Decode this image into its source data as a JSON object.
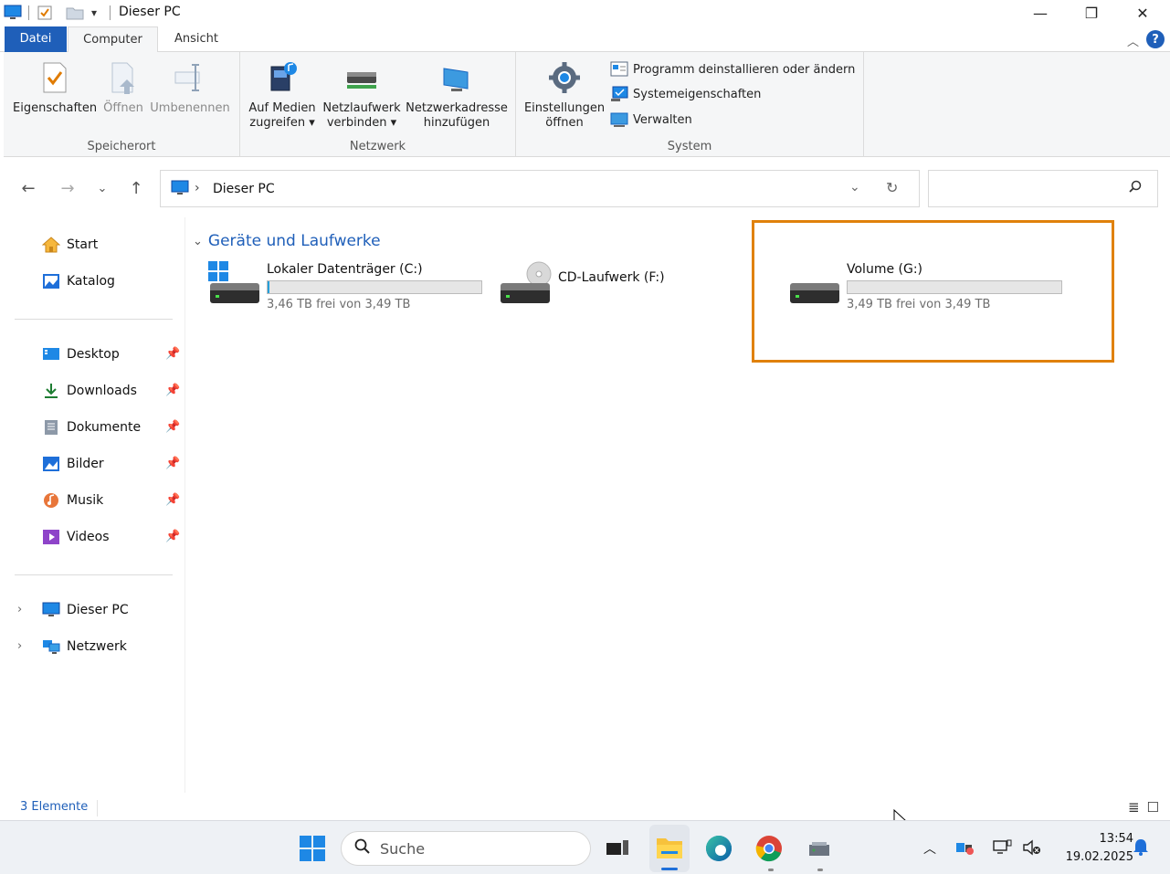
{
  "window": {
    "title": "Dieser PC",
    "minimize_glyph": "—",
    "restore_glyph": "❐",
    "close_glyph": "✕"
  },
  "ribbon": {
    "tabs": {
      "file": "Datei",
      "computer": "Computer",
      "view": "Ansicht"
    },
    "groups": {
      "location": {
        "label": "Speicherort",
        "buttons": {
          "properties": "Eigenschaften",
          "open": "Öffnen",
          "rename": "Umbenennen"
        }
      },
      "network": {
        "label": "Netzwerk",
        "buttons": {
          "media_line1": "Auf Medien",
          "media_line2": "zugreifen ▾",
          "map_drive_line1": "Netzlaufwerk",
          "map_drive_line2": "verbinden ▾",
          "add_location_line1": "Netzwerkadresse",
          "add_location_line2": "hinzufügen"
        }
      },
      "system": {
        "label": "System",
        "buttons": {
          "settings_line1": "Einstellungen",
          "settings_line2": "öffnen",
          "uninstall": "Programm deinstallieren oder ändern",
          "system_properties": "Systemeigenschaften",
          "manage": "Verwalten"
        }
      }
    }
  },
  "address_bar": {
    "path": "Dieser PC",
    "separator": "›"
  },
  "sidebar": {
    "top": [
      {
        "label": "Start",
        "icon": "home-icon"
      },
      {
        "label": "Katalog",
        "icon": "gallery-icon"
      }
    ],
    "pinned": [
      {
        "label": "Desktop",
        "icon": "desktop-icon"
      },
      {
        "label": "Downloads",
        "icon": "download-icon"
      },
      {
        "label": "Dokumente",
        "icon": "documents-icon"
      },
      {
        "label": "Bilder",
        "icon": "pictures-icon"
      },
      {
        "label": "Musik",
        "icon": "music-icon"
      },
      {
        "label": "Videos",
        "icon": "videos-icon"
      }
    ],
    "tree": [
      {
        "label": "Dieser PC",
        "icon": "this-pc-icon"
      },
      {
        "label": "Netzwerk",
        "icon": "network-icon"
      }
    ]
  },
  "content": {
    "section_title": "Geräte und Laufwerke",
    "drives": [
      {
        "name": "Lokaler Datenträger (C:)",
        "free_text": "3,46 TB frei von 3,49 TB",
        "used_fraction": 0.009
      },
      {
        "name": "CD-Laufwerk (F:)"
      },
      {
        "name": "Volume (G:)",
        "free_text": "3,49 TB frei von 3,49 TB",
        "used_fraction": 0.0
      }
    ]
  },
  "status_bar": {
    "item_count": "3 Elemente"
  },
  "taskbar": {
    "search_label": "Suche",
    "time": "13:54",
    "date": "19.02.2025"
  },
  "colors": {
    "accent": "#1f5fb9",
    "highlight": "#e0810b",
    "bar_fill": "#26a0da"
  }
}
